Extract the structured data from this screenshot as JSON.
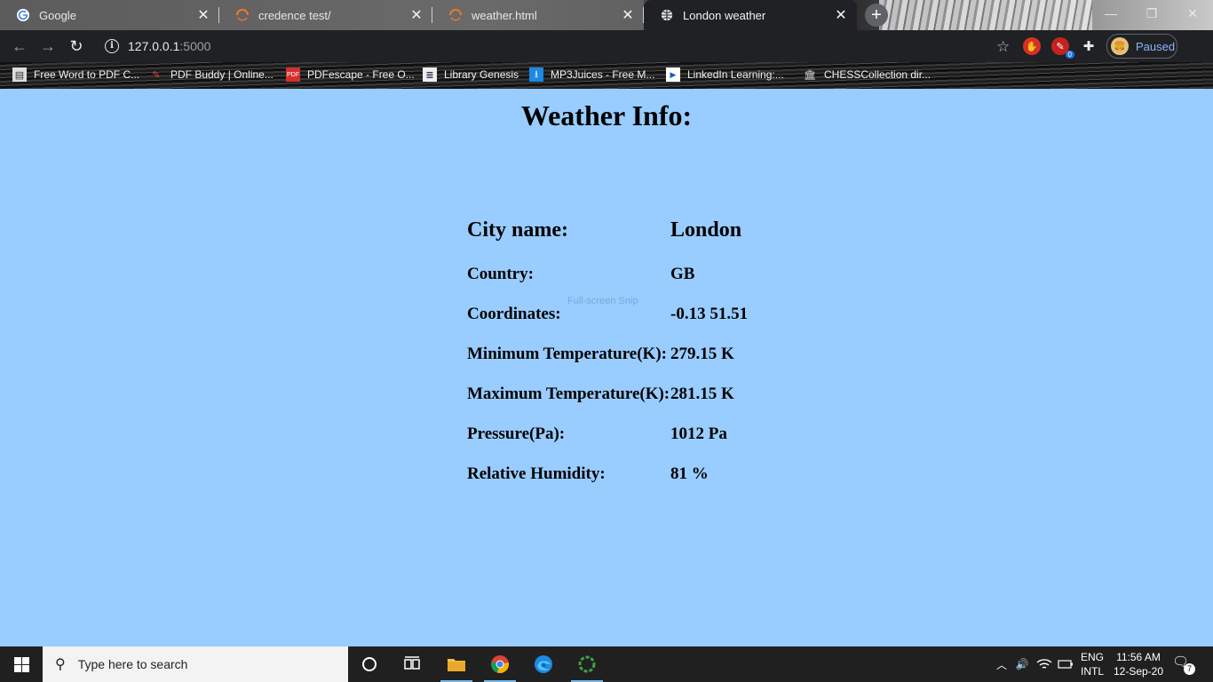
{
  "browser": {
    "tabs": [
      {
        "label": "Google",
        "icon": "google-icon",
        "active": false
      },
      {
        "label": "credence test/",
        "icon": "loading-icon",
        "active": false
      },
      {
        "label": "weather.html",
        "icon": "loading-icon",
        "active": false
      },
      {
        "label": "London weather",
        "icon": "globe-icon",
        "active": true
      }
    ],
    "url_host": "127.0.0.1",
    "url_port": ":5000",
    "profile_label": "Paused",
    "extension_badge": "0",
    "bookmarks": [
      {
        "label": "Free Word to PDF C...",
        "icon": "document-icon"
      },
      {
        "label": "PDF Buddy | Online...",
        "icon": "pen-icon"
      },
      {
        "label": "PDFescape - Free O...",
        "icon": "pdf-icon"
      },
      {
        "label": "Library Genesis",
        "icon": "library-icon"
      },
      {
        "label": "MP3Juices - Free M...",
        "icon": "download-icon"
      },
      {
        "label": "LinkedIn Learning:...",
        "icon": "play-icon"
      },
      {
        "label": "CHESSCollection dir...",
        "icon": "museum-icon"
      }
    ]
  },
  "page": {
    "title": "Weather Info:",
    "rows": [
      {
        "label": "City name:",
        "value": "London"
      },
      {
        "label": "Country:",
        "value": "GB"
      },
      {
        "label": "Coordinates:",
        "value": "-0.13 51.51"
      },
      {
        "label": "Minimum Temperature(K):",
        "value": "279.15 K"
      },
      {
        "label": "Maximum Temperature(K):",
        "value": "281.15 K"
      },
      {
        "label": "Pressure(Pa):",
        "value": "1012 Pa"
      },
      {
        "label": "Relative Humidity:",
        "value": "81 %"
      }
    ],
    "snip_hint": "Full-screen Snip",
    "background_color": "#99ccff"
  },
  "taskbar": {
    "search_placeholder": "Type here to search",
    "lang_line1": "ENG",
    "lang_line2": "INTL",
    "time": "11:56 AM",
    "date": "12-Sep-20",
    "notification_count": "7"
  }
}
